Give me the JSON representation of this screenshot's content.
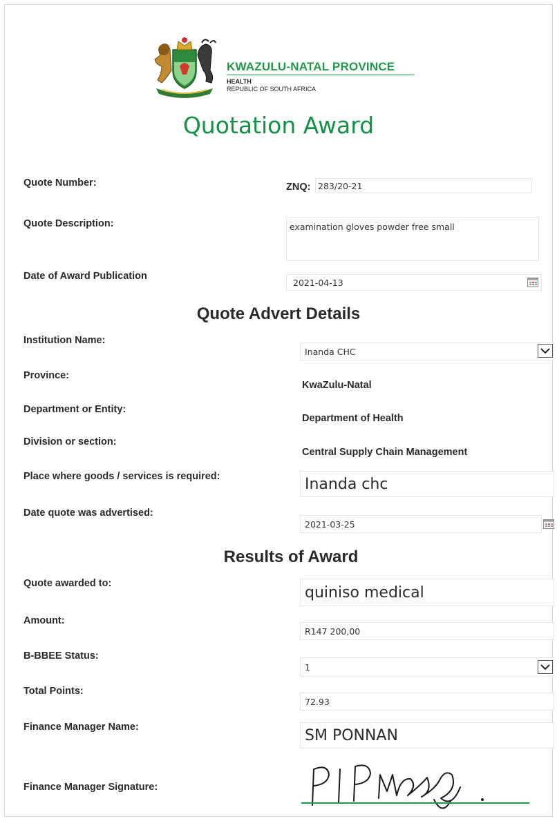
{
  "header": {
    "org_name": "KWAZULU-NATAL PROVINCE",
    "dept": "HEALTH",
    "country": "REPUBLIC OF SOUTH AFRICA",
    "title": "Quotation Award"
  },
  "quote": {
    "number_label": "Quote Number:",
    "number_prefix": "ZNQ:",
    "number_value": "283/20-21",
    "description_label": "Quote Description:",
    "description_value": "examination gloves powder free small",
    "award_date_label": "Date of Award Publication",
    "award_date_value": "2021-04-13"
  },
  "advert": {
    "heading": "Quote Advert Details",
    "institution_label": "Institution Name:",
    "institution_value": "Inanda CHC",
    "province_label": "Province:",
    "province_value": "KwaZulu-Natal",
    "department_label": "Department or Entity:",
    "department_value": "Department of Health",
    "division_label": "Division or section:",
    "division_value": "Central Supply Chain Management",
    "place_label": "Place where goods /  services is required:",
    "place_value": "Inanda chc",
    "advertised_label": "Date quote was advertised:",
    "advertised_value": "2021-03-25"
  },
  "results": {
    "heading": "Results of Award",
    "awarded_label": "Quote awarded to:",
    "awarded_value": "quiniso medical",
    "amount_label": "Amount:",
    "amount_value": "R147 200,00",
    "bbbee_label": "B-BBEE Status:",
    "bbbee_value": "1",
    "points_label": "Total Points:",
    "points_value": "72.93",
    "manager_label": "Finance Manager Name:",
    "manager_value": "SM PONNAN",
    "signature_label": "Finance Manager Signature:"
  },
  "colors": {
    "brand_green": "#1f9a4a",
    "title_green": "#149145"
  },
  "icons": [
    "coat-of-arms-logo",
    "calendar-icon",
    "chevron-down-icon"
  ]
}
